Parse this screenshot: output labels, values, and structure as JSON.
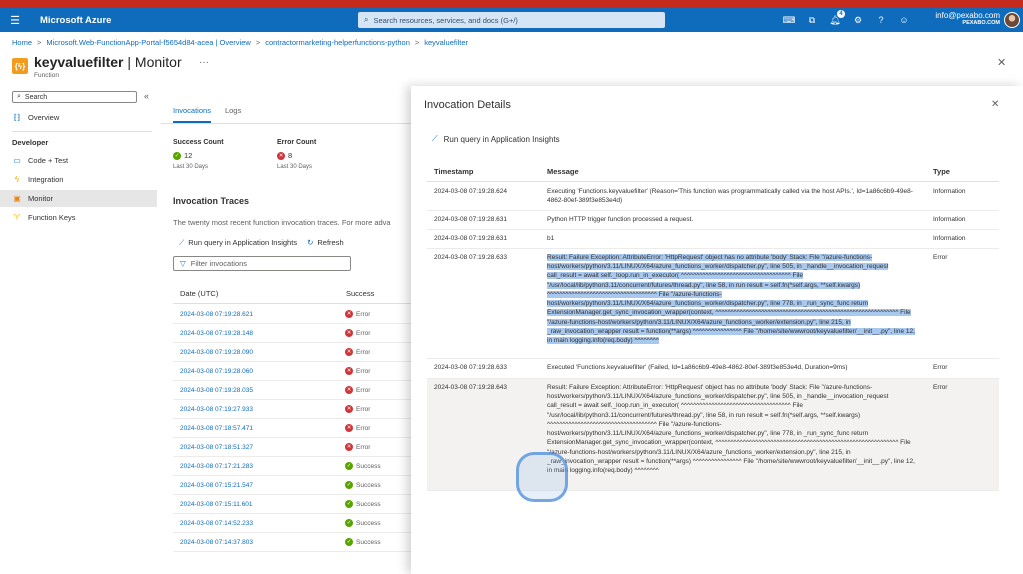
{
  "topbar": {
    "brand": "Microsoft Azure",
    "search_placeholder": "Search resources, services, and docs (G+/)",
    "notifications_count": "4",
    "account_email": "info@pexabo.com",
    "account_org": "PEXABO.COM"
  },
  "breadcrumb": {
    "items": [
      "Home",
      "Microsoft.Web-FunctionApp-Portal-f5654d84-acea | Overview",
      "contractormarketing-helperfunctions-python",
      "keyvaluefilter"
    ]
  },
  "resource": {
    "icon_text": "{ϟ}",
    "name": "keyvaluefilter",
    "separator": " | ",
    "blade": "Monitor",
    "type": "Function",
    "more": "···"
  },
  "nav": {
    "search_label": "Search",
    "overview": "Overview",
    "section_developer": "Developer",
    "items": [
      "Code + Test",
      "Integration",
      "Monitor",
      "Function Keys"
    ]
  },
  "main": {
    "tabs": [
      "Invocations",
      "Logs"
    ],
    "success": {
      "label": "Success Count",
      "value": "12",
      "sub": "Last 30 Days"
    },
    "error": {
      "label": "Error Count",
      "value": "8",
      "sub": "Last 30 Days"
    },
    "traces_title": "Invocation Traces",
    "traces_desc": "The twenty most recent function invocation traces. For more adva",
    "run_query": "Run query in Application Insights",
    "refresh": "Refresh",
    "filter_placeholder": "Filter invocations",
    "col_date": "Date (UTC)",
    "col_success": "Success",
    "rows": [
      {
        "date": "2024-03-08 07:19:28.621",
        "status": "Error"
      },
      {
        "date": "2024-03-08 07:19:28.148",
        "status": "Error"
      },
      {
        "date": "2024-03-08 07:19:28.090",
        "status": "Error"
      },
      {
        "date": "2024-03-08 07:19:28.060",
        "status": "Error"
      },
      {
        "date": "2024-03-08 07:19:28.035",
        "status": "Error"
      },
      {
        "date": "2024-03-08 07:19:27.933",
        "status": "Error"
      },
      {
        "date": "2024-03-08 07:18:57.471",
        "status": "Error"
      },
      {
        "date": "2024-03-08 07:18:51.327",
        "status": "Error"
      },
      {
        "date": "2024-03-08 07:17:21.283",
        "status": "Success"
      },
      {
        "date": "2024-03-08 07:15:21.547",
        "status": "Success"
      },
      {
        "date": "2024-03-08 07:15:11.601",
        "status": "Success"
      },
      {
        "date": "2024-03-08 07:14:52.233",
        "status": "Success"
      },
      {
        "date": "2024-03-08 07:14:37.803",
        "status": "Success"
      }
    ]
  },
  "panel": {
    "title": "Invocation Details",
    "run_query": "Run query in Application Insights",
    "col_timestamp": "Timestamp",
    "col_message": "Message",
    "col_type": "Type",
    "rows": [
      {
        "timestamp": "2024-03-08 07:19:28.624",
        "message": "Executing 'Functions.keyvaluefilter' (Reason='This function was programmatically called via the host APIs.', Id=1a86c6b9-49e8-4862-80ef-389f3e853e4d)",
        "type": "Information"
      },
      {
        "timestamp": "2024-03-08 07:19:28.631",
        "message": "Python HTTP trigger function processed a request.",
        "type": "Information"
      },
      {
        "timestamp": "2024-03-08 07:19:28.631",
        "message": "b1",
        "type": "Information"
      },
      {
        "timestamp": "2024-03-08 07:19:28.633",
        "message": "Result: Failure Exception: AttributeError: 'HttpRequest' object has no attribute 'body' Stack: File \"/azure-functions-host/workers/python/3.11/LINUX/X64/azure_functions_worker/dispatcher.py\", line 505, in _handle__invocation_request call_result = await self._loop.run_in_executor( ^^^^^^^^^^^^^^^^^^^^^^^^^^^^^^^^^^^^ File \"/usr/local/lib/python3.11/concurrent/futures/thread.py\", line 58, in run result = self.fn(*self.args, **self.kwargs) ^^^^^^^^^^^^^^^^^^^^^^^^^^^^^^^^^^^^ File \"/azure-functions-host/workers/python/3.11/LINUX/X64/azure_functions_worker/dispatcher.py\", line 778, in _run_sync_func return ExtensionManager.get_sync_invocation_wrapper(context, ^^^^^^^^^^^^^^^^^^^^^^^^^^^^^^^^^^^^^^^^^^^^^^^^^^^^^^^^^^^^ File \"/azure-functions-host/workers/python/3.11/LINUX/X64/azure_functions_worker/extension.py\", line 215, in _raw_invocation_wrapper result = function(**args) ^^^^^^^^^^^^^^^^ File \"/home/site/wwwroot/keyvaluefilter/__init__.py\", line 12, in main logging.info(req.body) ^^^^^^^^",
        "type": "Error"
      },
      {
        "timestamp": "2024-03-08 07:19:28.633",
        "message": "Executed 'Functions.keyvaluefilter' (Failed, Id=1a86c6b9-49e8-4862-80ef-389f3e853e4d, Duration=9ms)",
        "type": "Error"
      },
      {
        "timestamp": "2024-03-08 07:19:28.643",
        "message": "Result: Failure Exception: AttributeError: 'HttpRequest' object has no attribute 'body' Stack: File \"/azure-functions-host/workers/python/3.11/LINUX/X64/azure_functions_worker/dispatcher.py\", line 505, in _handle__invocation_request call_result = await self._loop.run_in_executor( ^^^^^^^^^^^^^^^^^^^^^^^^^^^^^^^^^^^^ File \"/usr/local/lib/python3.11/concurrent/futures/thread.py\", line 58, in run result = self.fn(*self.args, **self.kwargs) ^^^^^^^^^^^^^^^^^^^^^^^^^^^^^^^^^^^^ File \"/azure-functions-host/workers/python/3.11/LINUX/X64/azure_functions_worker/dispatcher.py\", line 778, in _run_sync_func return ExtensionManager.get_sync_invocation_wrapper(context, ^^^^^^^^^^^^^^^^^^^^^^^^^^^^^^^^^^^^^^^^^^^^^^^^^^^^^^^^^^^^ File \"/azure-functions-host/workers/python/3.11/LINUX/X64/azure_functions_worker/extension.py\", line 215, in _raw_invocation_wrapper result = function(**args) ^^^^^^^^^^^^^^^^ File \"/home/site/wwwroot/keyvaluefilter/__init__.py\", line 12, in main logging.info(req.body) ^^^^^^^^",
        "type": "Error"
      }
    ]
  },
  "colors": {
    "header_blue": "#0f6cbd",
    "top_strip_red": "#c42b1c",
    "error_red": "#d13438",
    "success_green": "#57a300",
    "selection_blue": "#a9c8ee"
  }
}
